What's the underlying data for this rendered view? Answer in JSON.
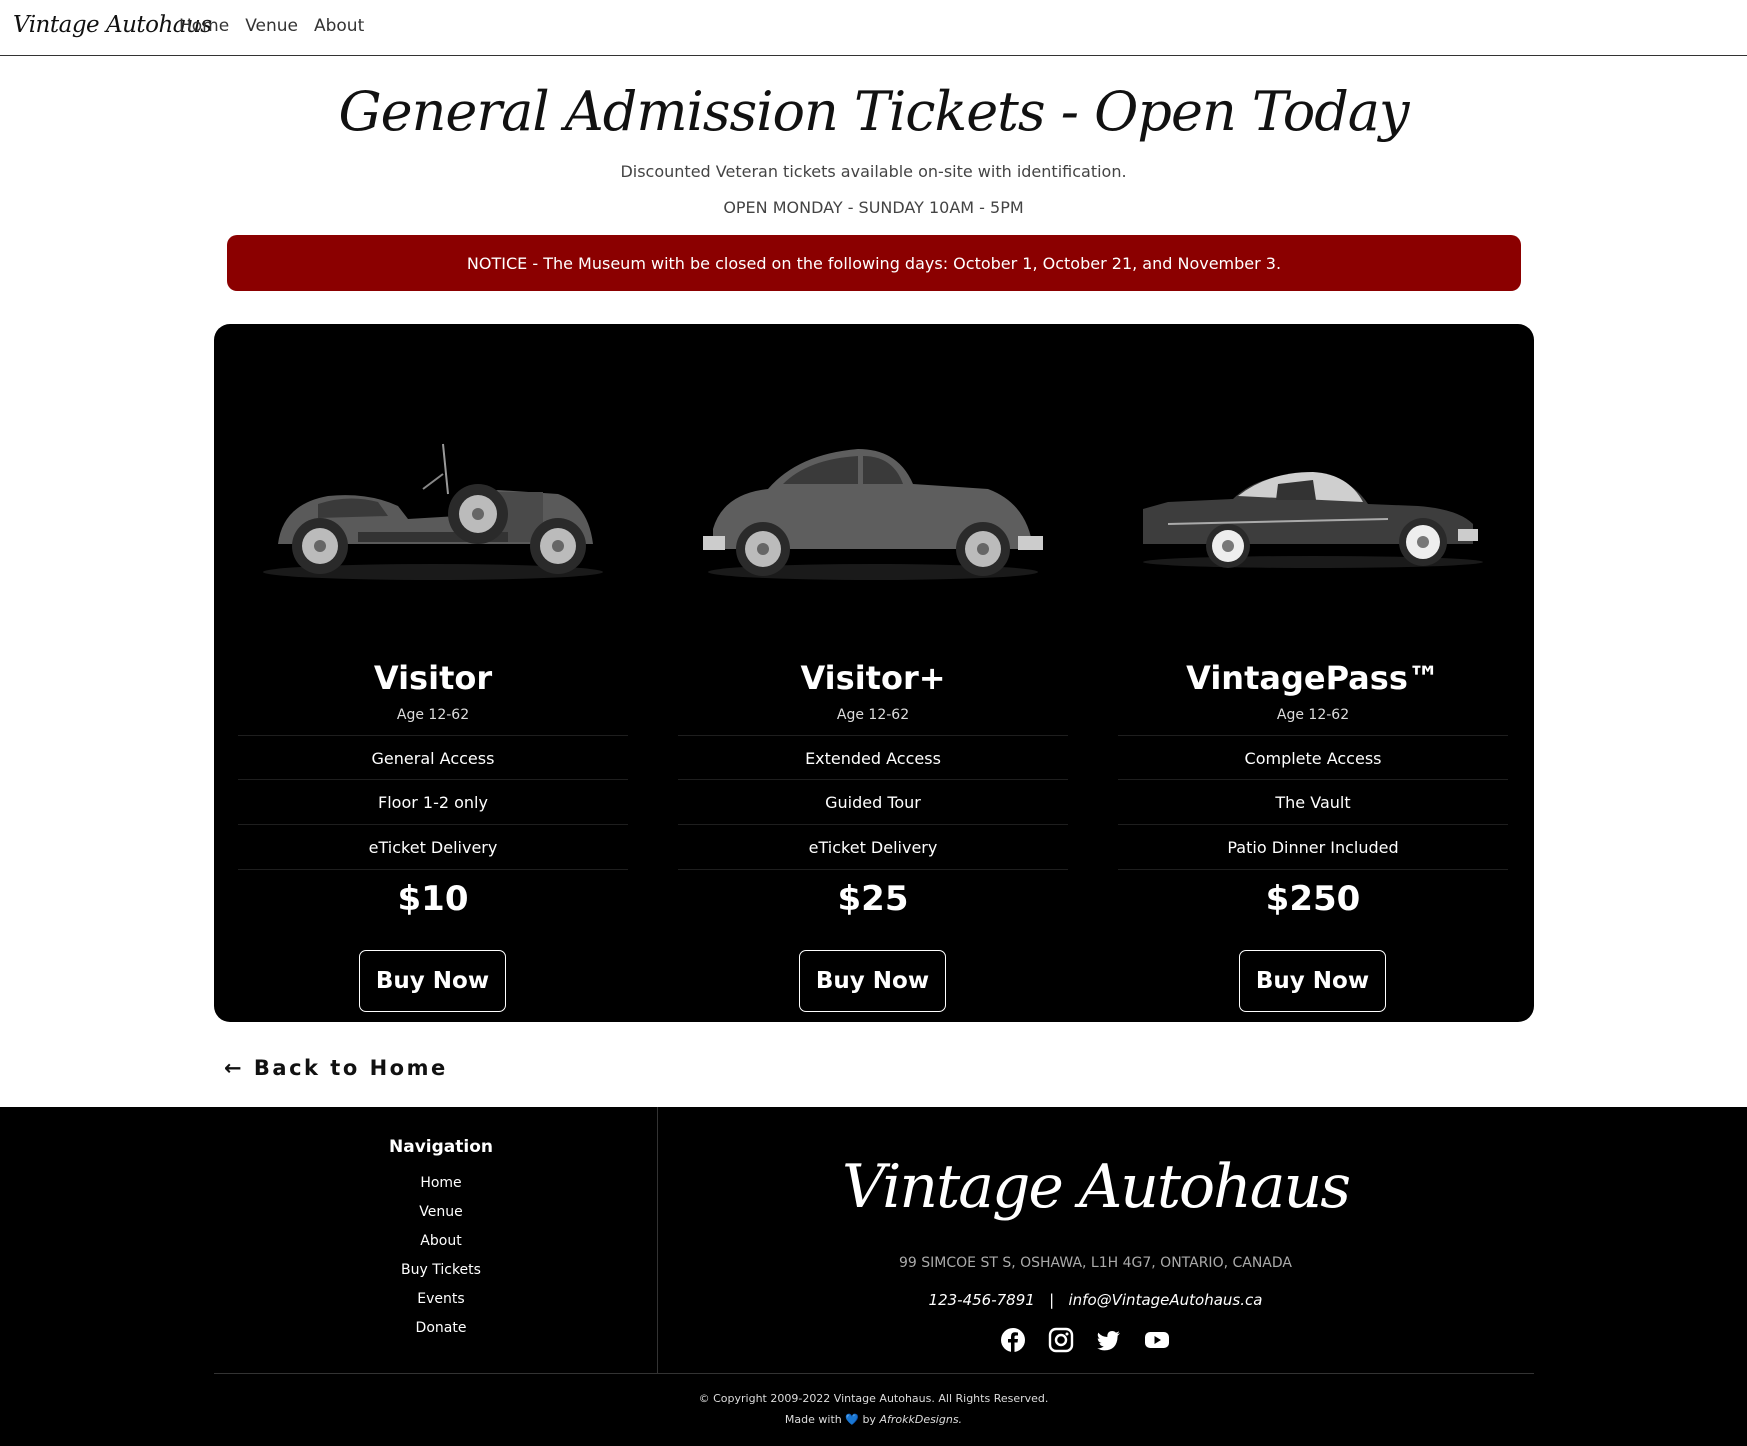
{
  "navbar": {
    "brand": "Vintage Autohaus",
    "links": [
      "Home",
      "Venue",
      "About"
    ]
  },
  "hero": {
    "title": "General Admission Tickets - Open Today",
    "subtitle": "Discounted Veteran tickets available on-site with identification.",
    "hours": "OPEN MONDAY - SUNDAY 10AM - 5PM"
  },
  "notice": "NOTICE - The Museum with be closed on the following days: October 1, October 21, and November 3.",
  "plans": [
    {
      "name": "Visitor",
      "age": "Age 12-62",
      "features": [
        "General Access",
        "Floor 1-2 only",
        "eTicket Delivery"
      ],
      "price": "$10",
      "button": "Buy Now",
      "icon": "roadster-car-icon"
    },
    {
      "name": "Visitor+",
      "age": "Age 12-62",
      "features": [
        "Extended Access",
        "Guided Tour",
        "eTicket Delivery"
      ],
      "price": "$25",
      "button": "Buy Now",
      "icon": "coupe-car-icon"
    },
    {
      "name": "VintagePass™",
      "age": "Age 12-62",
      "features": [
        "Complete Access",
        "The Vault",
        "Patio Dinner Included"
      ],
      "price": "$250",
      "button": "Buy Now",
      "icon": "cadillac-car-icon"
    }
  ],
  "back_link": "← Back to Home",
  "footer": {
    "nav_heading": "Navigation",
    "nav_links": [
      "Home",
      "Venue",
      "About",
      "Buy Tickets",
      "Events",
      "Donate"
    ],
    "brand": "Vintage Autohaus",
    "address": "99 SIMCOE ST S, OSHAWA, L1H 4G7, ONTARIO, CANADA",
    "phone": "123-456-7891",
    "separator": "|",
    "email": "info@VintageAutohaus.ca",
    "socials": [
      "facebook-icon",
      "instagram-icon",
      "twitter-icon",
      "youtube-icon"
    ],
    "copyright": "© Copyright 2009-2022 Vintage Autohaus. All Rights Reserved.",
    "made_with": "Made with",
    "heart": "💙",
    "by": "by",
    "author": "AfrokkDesigns."
  },
  "colors": {
    "notice_bg": "#8b0000",
    "panel_bg": "#000000",
    "heart": "#2b8fd8"
  }
}
